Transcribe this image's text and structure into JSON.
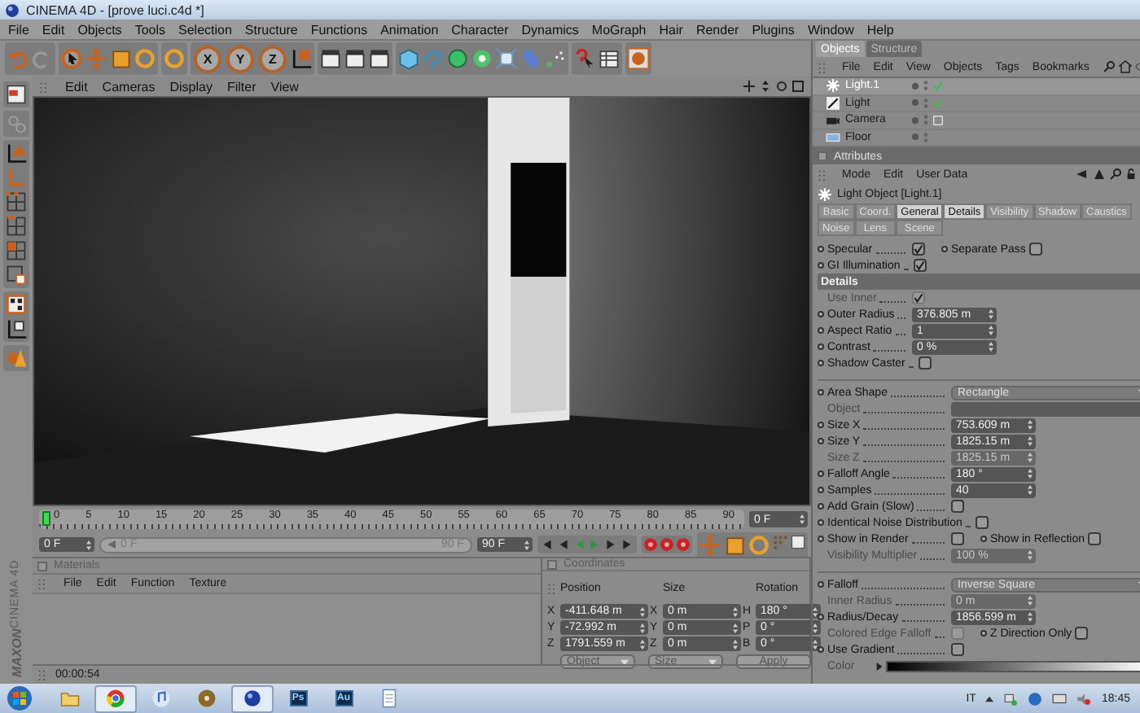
{
  "window": {
    "title": "CINEMA 4D - [prove luci.c4d *]"
  },
  "menu": [
    "File",
    "Edit",
    "Objects",
    "Tools",
    "Selection",
    "Structure",
    "Functions",
    "Animation",
    "Character",
    "Dynamics",
    "MoGraph",
    "Hair",
    "Render",
    "Plugins",
    "Window",
    "Help"
  ],
  "toolbar": {
    "axes": [
      "X",
      "Y",
      "Z"
    ]
  },
  "viewport": {
    "menu": [
      "Edit",
      "Cameras",
      "Display",
      "Filter",
      "View"
    ]
  },
  "timeline": {
    "ticks": [
      "0",
      "5",
      "10",
      "15",
      "20",
      "25",
      "30",
      "35",
      "40",
      "45",
      "50",
      "55",
      "60",
      "65",
      "70",
      "75",
      "80",
      "85",
      "90"
    ],
    "current_frame": "0 F",
    "start": "0 F",
    "range": {
      "start": "0 F",
      "end": "90 F",
      "level": 1
    },
    "end": "90 F"
  },
  "materials": {
    "title": "Materials",
    "menu": [
      "File",
      "Edit",
      "Function",
      "Texture"
    ]
  },
  "coordinates": {
    "title": "Coordinates",
    "headers": [
      "Position",
      "Size",
      "Rotation"
    ],
    "rows": [
      {
        "pos_axis": "X",
        "position": "-411.648 m",
        "size_axis": "X",
        "size": "0 m",
        "rot_axis": "H",
        "rotation": "180 °"
      },
      {
        "pos_axis": "Y",
        "position": "-72.992 m",
        "size_axis": "Y",
        "size": "0 m",
        "rot_axis": "P",
        "rotation": "0 °"
      },
      {
        "pos_axis": "Z",
        "position": "1791.559 m",
        "size_axis": "Z",
        "size": "0 m",
        "rot_axis": "B",
        "rotation": "0 °"
      }
    ],
    "mode": "Object",
    "size_mode": "Size",
    "apply": "Apply"
  },
  "status_bar": {
    "time": "00:00:54"
  },
  "logo": {
    "brand": "MAXON",
    "product": "CINEMA 4D"
  },
  "objects": {
    "tabs": [
      {
        "label": "Objects",
        "selected": true
      },
      {
        "label": "Structure",
        "selected": false
      }
    ],
    "menu": [
      "File",
      "Edit",
      "View",
      "Objects",
      "Tags",
      "Bookmarks"
    ],
    "items": [
      {
        "name": "Light.1",
        "kind": "light",
        "selected": true,
        "enabled": true
      },
      {
        "name": "Light",
        "kind": "area-light",
        "selected": false,
        "enabled": true
      },
      {
        "name": "Camera",
        "kind": "camera",
        "selected": false,
        "enabled": false
      },
      {
        "name": "Floor",
        "kind": "floor",
        "selected": false,
        "enabled": false
      }
    ]
  },
  "attributes": {
    "title": "Attributes",
    "menu": [
      "Mode",
      "Edit",
      "User Data"
    ],
    "object": "Light Object [Light.1]",
    "tabs": [
      {
        "label": "Basic",
        "selected": false
      },
      {
        "label": "Coord.",
        "selected": false
      },
      {
        "label": "General",
        "selected": true
      },
      {
        "label": "Details",
        "selected": true
      },
      {
        "label": "Visibility",
        "selected": false
      },
      {
        "label": "Shadow",
        "selected": false
      },
      {
        "label": "Caustics",
        "selected": false
      },
      {
        "label": "Noise",
        "selected": false
      },
      {
        "label": "Lens",
        "selected": false
      },
      {
        "label": "Scene",
        "selected": false
      }
    ],
    "rows": [
      {
        "kind": "check-pair",
        "items": [
          {
            "label": "Specular",
            "checked": true,
            "disabled": false
          },
          {
            "label": "Separate Pass",
            "checked": false,
            "disabled": false
          }
        ]
      },
      {
        "kind": "check",
        "label": "GI Illumination",
        "checked": true,
        "disabled": false
      },
      {
        "kind": "header",
        "label": "Details"
      },
      {
        "kind": "check",
        "label": "Use Inner",
        "checked": true,
        "disabled": true
      },
      {
        "kind": "number",
        "label": "Outer Radius",
        "value": "376.805 m",
        "disabled": false
      },
      {
        "kind": "number",
        "label": "Aspect Ratio",
        "value": "1",
        "disabled": false
      },
      {
        "kind": "number",
        "label": "Contrast",
        "value": "0 %",
        "disabled": false
      },
      {
        "kind": "check",
        "label": "Shadow Caster",
        "checked": false,
        "disabled": false
      },
      {
        "kind": "separator"
      },
      {
        "kind": "dropdown",
        "label": "Area Shape",
        "value": "Rectangle",
        "disabled": false
      },
      {
        "kind": "link",
        "label": "Object",
        "disabled": true
      },
      {
        "kind": "number",
        "label": "Size X",
        "value": "753.609 m",
        "disabled": false
      },
      {
        "kind": "number",
        "label": "Size Y",
        "value": "1825.15 m",
        "disabled": false
      },
      {
        "kind": "number",
        "label": "Size Z",
        "value": "1825.15 m",
        "disabled": true
      },
      {
        "kind": "number",
        "label": "Falloff Angle",
        "value": "180 °",
        "disabled": false
      },
      {
        "kind": "number",
        "label": "Samples",
        "value": "40",
        "disabled": false
      },
      {
        "kind": "check",
        "label": "Add Grain (Slow)",
        "checked": false,
        "disabled": false
      },
      {
        "kind": "check",
        "label": "Identical Noise Distribution",
        "checked": false,
        "disabled": false
      },
      {
        "kind": "check-pair",
        "items": [
          {
            "label": "Show in Render",
            "checked": false,
            "disabled": false
          },
          {
            "label": "Show in Reflection",
            "checked": false,
            "disabled": false
          }
        ]
      },
      {
        "kind": "number",
        "label": "Visibility Multiplier",
        "value": "100 %",
        "disabled": true
      },
      {
        "kind": "separator"
      },
      {
        "kind": "dropdown",
        "label": "Falloff",
        "value": "Inverse Square",
        "disabled": false
      },
      {
        "kind": "number",
        "label": "Inner Radius",
        "value": "0 m",
        "disabled": true
      },
      {
        "kind": "number",
        "label": "Radius/Decay",
        "value": "1856.599 m",
        "disabled": false
      },
      {
        "kind": "check-pair",
        "items": [
          {
            "label": "Colored Edge Falloff",
            "checked": false,
            "disabled": true
          },
          {
            "label": "Z Direction Only",
            "checked": false,
            "disabled": false
          }
        ]
      },
      {
        "kind": "check",
        "label": "Use Gradient",
        "checked": false,
        "disabled": false
      },
      {
        "kind": "gradient",
        "label": "Color",
        "disabled": true
      }
    ]
  },
  "taskbar": {
    "apps": [
      {
        "kind": "folder",
        "selected": false
      },
      {
        "kind": "browser",
        "selected": true
      },
      {
        "kind": "music",
        "selected": false
      },
      {
        "kind": "disc",
        "selected": false
      },
      {
        "kind": "c4d",
        "selected": true
      },
      {
        "kind": "badge",
        "label": "Ps",
        "selected": false
      },
      {
        "kind": "badge",
        "label": "Au",
        "selected": false
      },
      {
        "kind": "notepad",
        "selected": false
      }
    ],
    "language": "IT",
    "time": "18:45"
  }
}
